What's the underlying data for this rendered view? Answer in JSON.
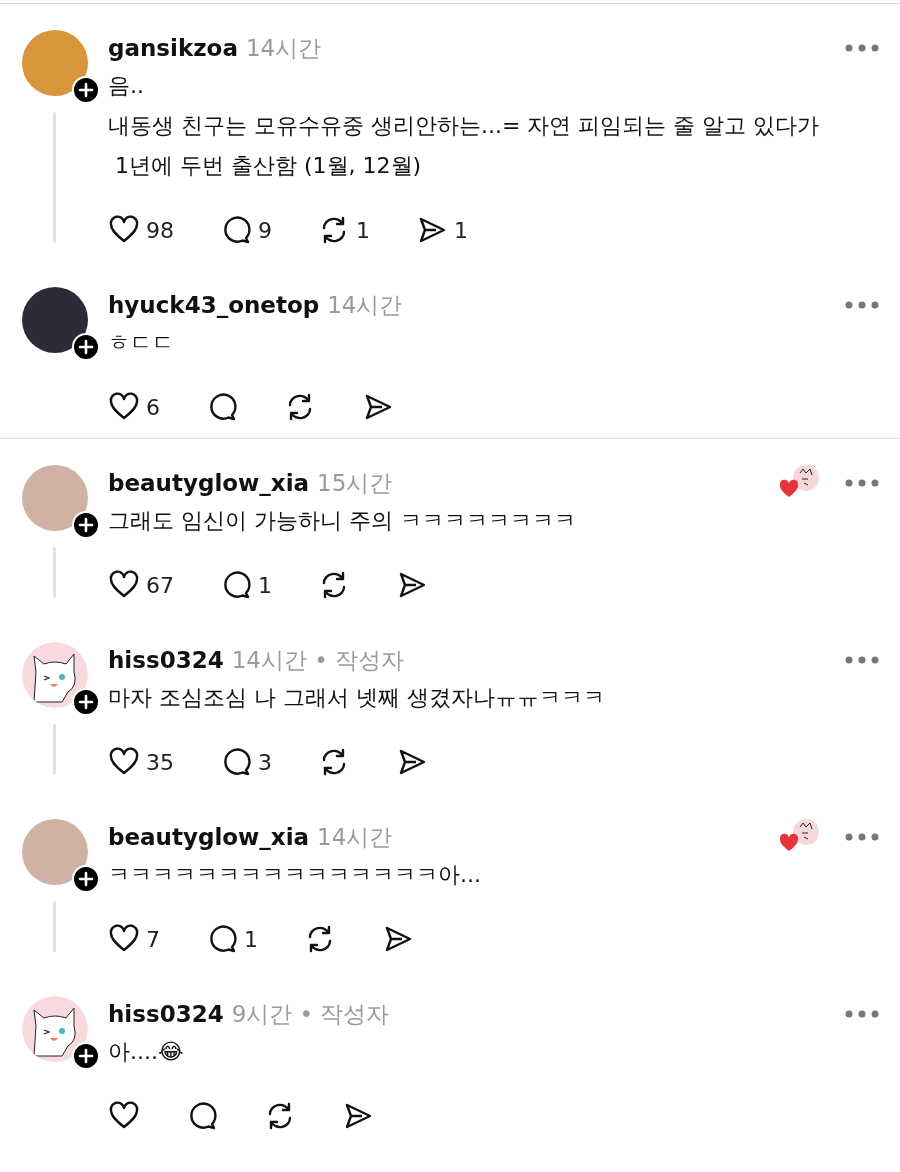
{
  "threads": [
    {
      "posts": [
        {
          "username": "gansikzoa",
          "meta": "14시간",
          "avatar": {
            "kind": "photo",
            "color": "#d8953a"
          },
          "thread_line": true,
          "author_liked": false,
          "lines": [
            "음..",
            "내동생 친구는 모유수유중 생리안하는...= 자연 피임되는 줄 알고 있다가",
            " 1년에 두번 출산함 (1월, 12월)"
          ],
          "actions": [
            {
              "kind": "like",
              "count": "98"
            },
            {
              "kind": "reply",
              "count": "9"
            },
            {
              "kind": "repost",
              "count": "1"
            },
            {
              "kind": "share",
              "count": "1"
            }
          ]
        },
        {
          "username": "hyuck43_onetop",
          "meta": "14시간",
          "avatar": {
            "kind": "photo",
            "color": "#2b2c38"
          },
          "thread_line": false,
          "author_liked": false,
          "lines": [
            "ㅎㄷㄷ"
          ],
          "actions": [
            {
              "kind": "like",
              "count": "6"
            },
            {
              "kind": "reply"
            },
            {
              "kind": "repost"
            },
            {
              "kind": "share"
            }
          ]
        }
      ]
    },
    {
      "posts": [
        {
          "username": "beautyglow_xia",
          "meta": "15시간",
          "avatar": {
            "kind": "photo",
            "color": "#cfb2a4"
          },
          "thread_line": true,
          "author_liked": true,
          "lines": [
            "그래도 임신이 가능하니 주의 ㅋㅋㅋㅋㅋㅋㅋㅋ"
          ],
          "actions": [
            {
              "kind": "like",
              "count": "67"
            },
            {
              "kind": "reply",
              "count": "1"
            },
            {
              "kind": "repost"
            },
            {
              "kind": "share"
            }
          ]
        },
        {
          "username": "hiss0324",
          "meta": "14시간 • 작성자",
          "avatar": {
            "kind": "cartoon",
            "color": "#f8dade"
          },
          "thread_line": true,
          "author_liked": false,
          "lines": [
            "마자 조심조심 나 그래서 넷째 생겼자나ㅠㅠㅋㅋㅋ"
          ],
          "actions": [
            {
              "kind": "like",
              "count": "35"
            },
            {
              "kind": "reply",
              "count": "3"
            },
            {
              "kind": "repost"
            },
            {
              "kind": "share"
            }
          ]
        },
        {
          "username": "beautyglow_xia",
          "meta": "14시간",
          "avatar": {
            "kind": "photo",
            "color": "#cfb2a4"
          },
          "thread_line": true,
          "author_liked": true,
          "lines": [
            "ㅋㅋㅋㅋㅋㅋㅋㅋㅋㅋㅋㅋㅋㅋㅋ아..."
          ],
          "actions": [
            {
              "kind": "like",
              "count": "7"
            },
            {
              "kind": "reply",
              "count": "1"
            },
            {
              "kind": "repost"
            },
            {
              "kind": "share"
            }
          ]
        },
        {
          "username": "hiss0324",
          "meta": "9시간 • 작성자",
          "avatar": {
            "kind": "cartoon",
            "color": "#f8dade"
          },
          "thread_line": false,
          "author_liked": false,
          "lines": [
            "아....😂"
          ],
          "actions": [
            {
              "kind": "like"
            },
            {
              "kind": "reply"
            },
            {
              "kind": "repost"
            },
            {
              "kind": "share"
            }
          ]
        }
      ]
    }
  ]
}
